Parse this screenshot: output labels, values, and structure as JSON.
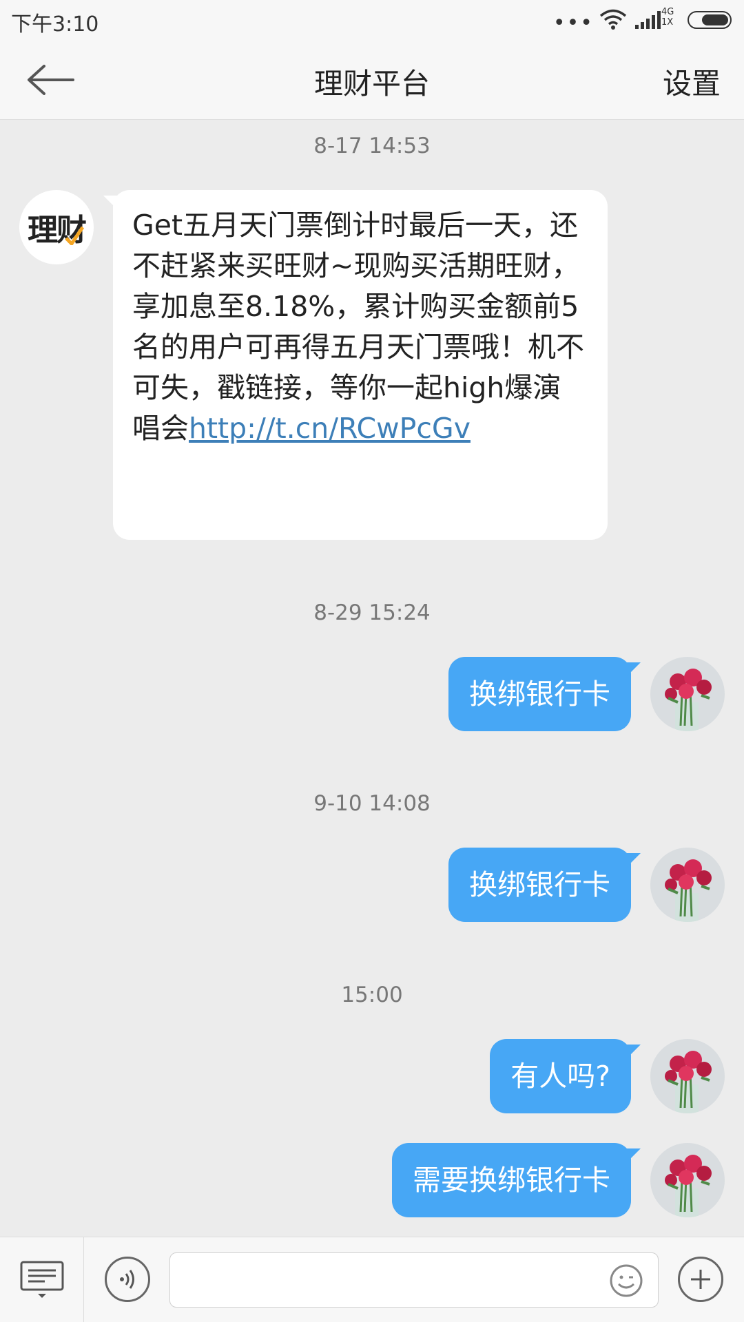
{
  "status_bar": {
    "time": "下午3:10",
    "network_top": "4G",
    "network_bottom": "1X",
    "icons": [
      "more-dots-icon",
      "wifi-icon",
      "signal-icon",
      "battery-icon"
    ]
  },
  "header": {
    "title": "理财平台",
    "back_icon": "arrow-left-icon",
    "settings_label": "设置"
  },
  "official_account": {
    "avatar_text": "理财"
  },
  "messages": [
    {
      "timestamp": "8-17 14:53",
      "direction": "incoming",
      "text": "Get五月天门票倒计时最后一天，还不赶紧来买旺财~现购买活期旺财，享加息至8.18%，累计购买金额前5名的用户可再得五月天门票哦！机不可失，戳链接，等你一起high爆演唱会",
      "link": "http://t.cn/RCwPcGv"
    },
    {
      "timestamp": "8-29 15:24",
      "direction": "outgoing",
      "text": "换绑银行卡"
    },
    {
      "timestamp": "9-10 14:08",
      "direction": "outgoing",
      "text": "换绑银行卡"
    },
    {
      "timestamp": "15:00",
      "direction": "outgoing",
      "text": "有人吗?"
    },
    {
      "timestamp": "",
      "direction": "outgoing",
      "text": "需要换绑银行卡"
    }
  ],
  "input_bar": {
    "menu_icon": "keyboard-menu-icon",
    "voice_icon": "voice-icon",
    "placeholder": "",
    "value": "",
    "emoji_icon": "emoji-icon",
    "plus_icon": "plus-icon"
  },
  "colors": {
    "outgoing_bubble": "#47a7f5",
    "incoming_bubble": "#ffffff",
    "link": "#3d7fb8",
    "background": "#ececec",
    "accent_orange": "#f5a623"
  }
}
